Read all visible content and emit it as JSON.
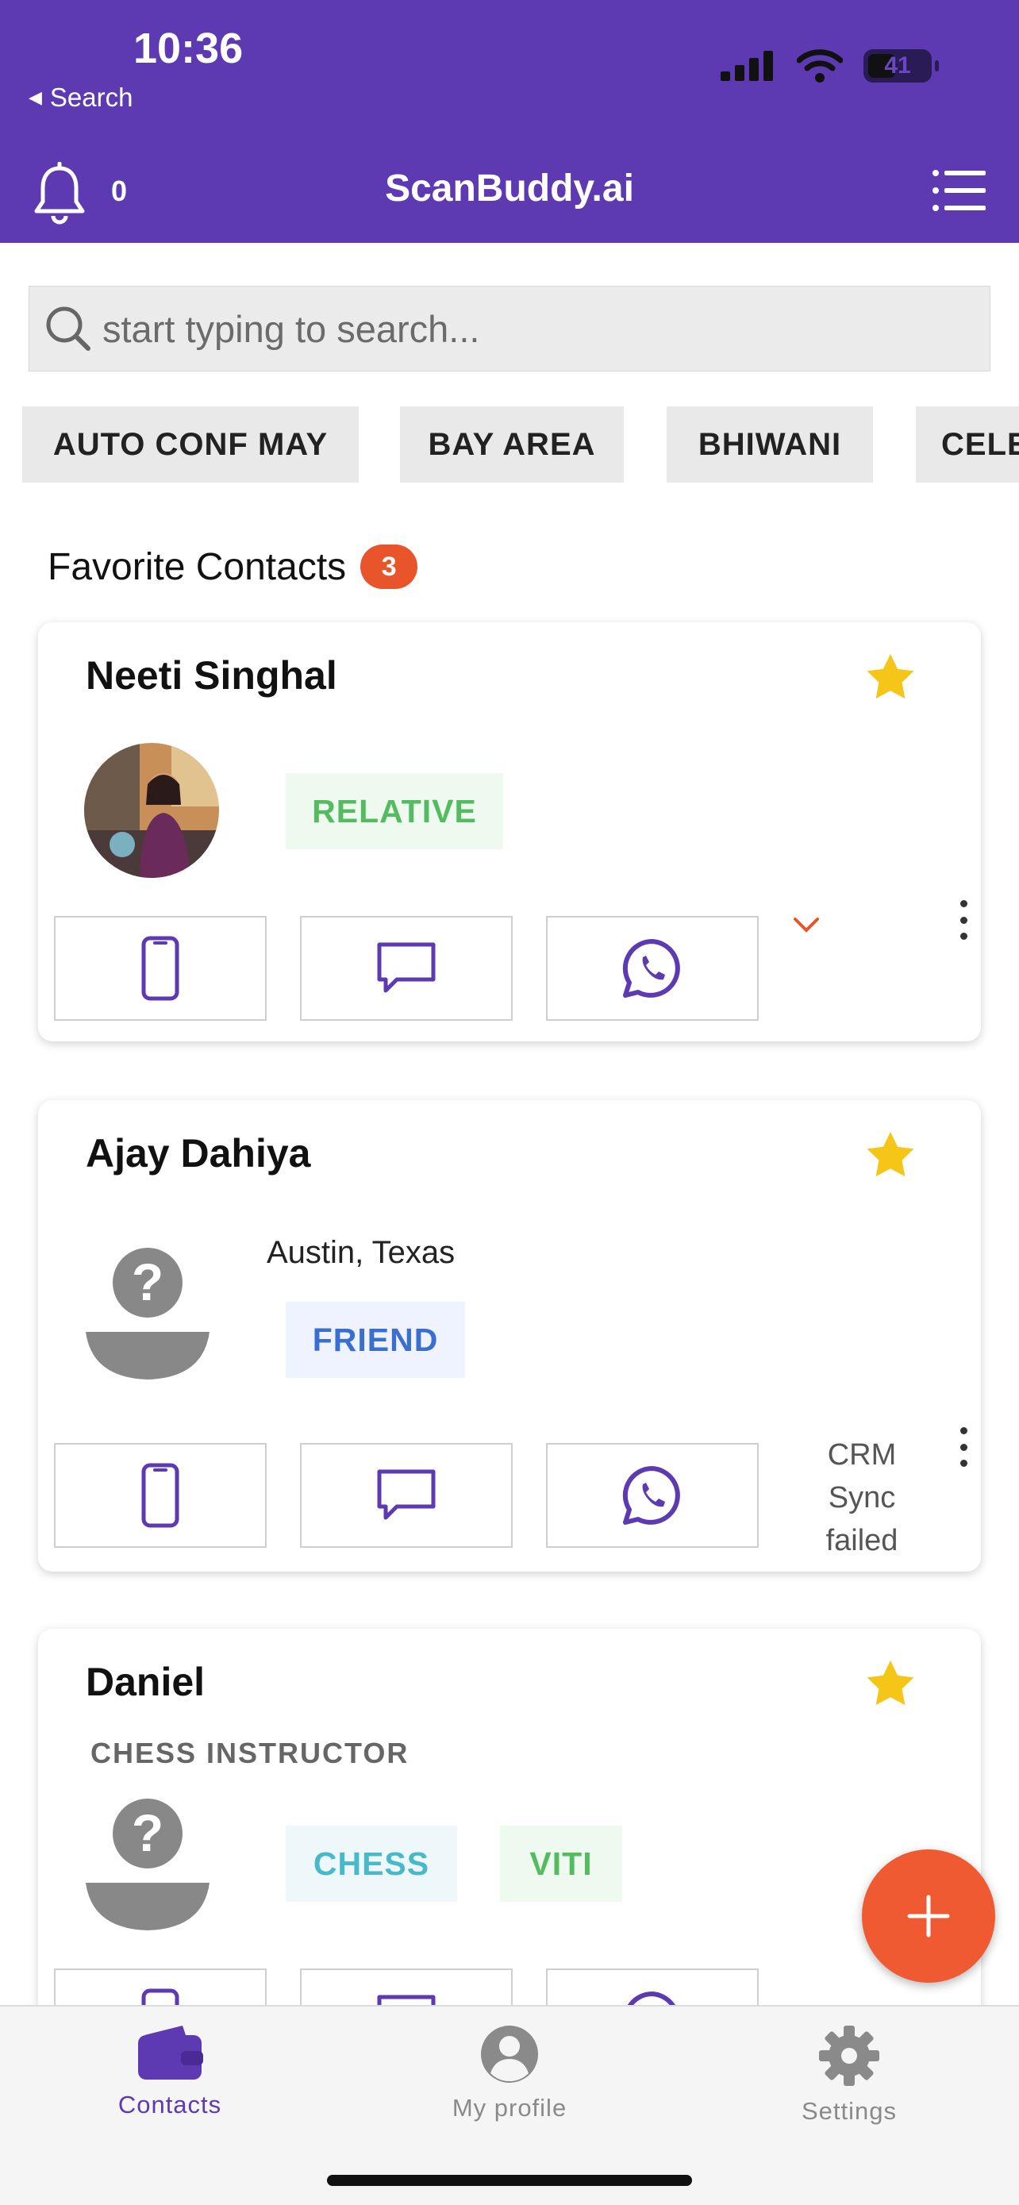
{
  "status_bar": {
    "time": "10:36",
    "back_label": "Search",
    "battery": "41"
  },
  "header": {
    "notification_count": "0",
    "title": "ScanBuddy.ai"
  },
  "search": {
    "placeholder": "start typing to search..."
  },
  "chips": [
    "AUTO CONF MAY",
    "BAY AREA",
    "BHIWANI",
    "CELE"
  ],
  "favorites": {
    "heading": "Favorite Contacts",
    "count": "3"
  },
  "contacts": [
    {
      "name": "Neeti Singhal",
      "tags": [
        "RELATIVE"
      ]
    },
    {
      "name": "Ajay Dahiya",
      "location": "Austin, Texas",
      "tags": [
        "FRIEND"
      ],
      "status_lines": [
        "CRM",
        "Sync",
        "failed"
      ]
    },
    {
      "name": "Daniel",
      "title": "CHESS INSTRUCTOR",
      "tags": [
        "CHESS",
        "VITI"
      ]
    }
  ],
  "bottom_nav": [
    {
      "label": "Contacts",
      "icon": "wallet-icon"
    },
    {
      "label": "My profile",
      "icon": "profile-icon"
    },
    {
      "label": "Settings",
      "icon": "gear-icon"
    }
  ],
  "colors": {
    "brand": "#5e3ab2",
    "accent": "#ef5a32",
    "star": "#f5c518",
    "relative_tag": "#55bb60",
    "friend_tag": "#3a6fd0",
    "chess_tag": "#49b8c8"
  }
}
